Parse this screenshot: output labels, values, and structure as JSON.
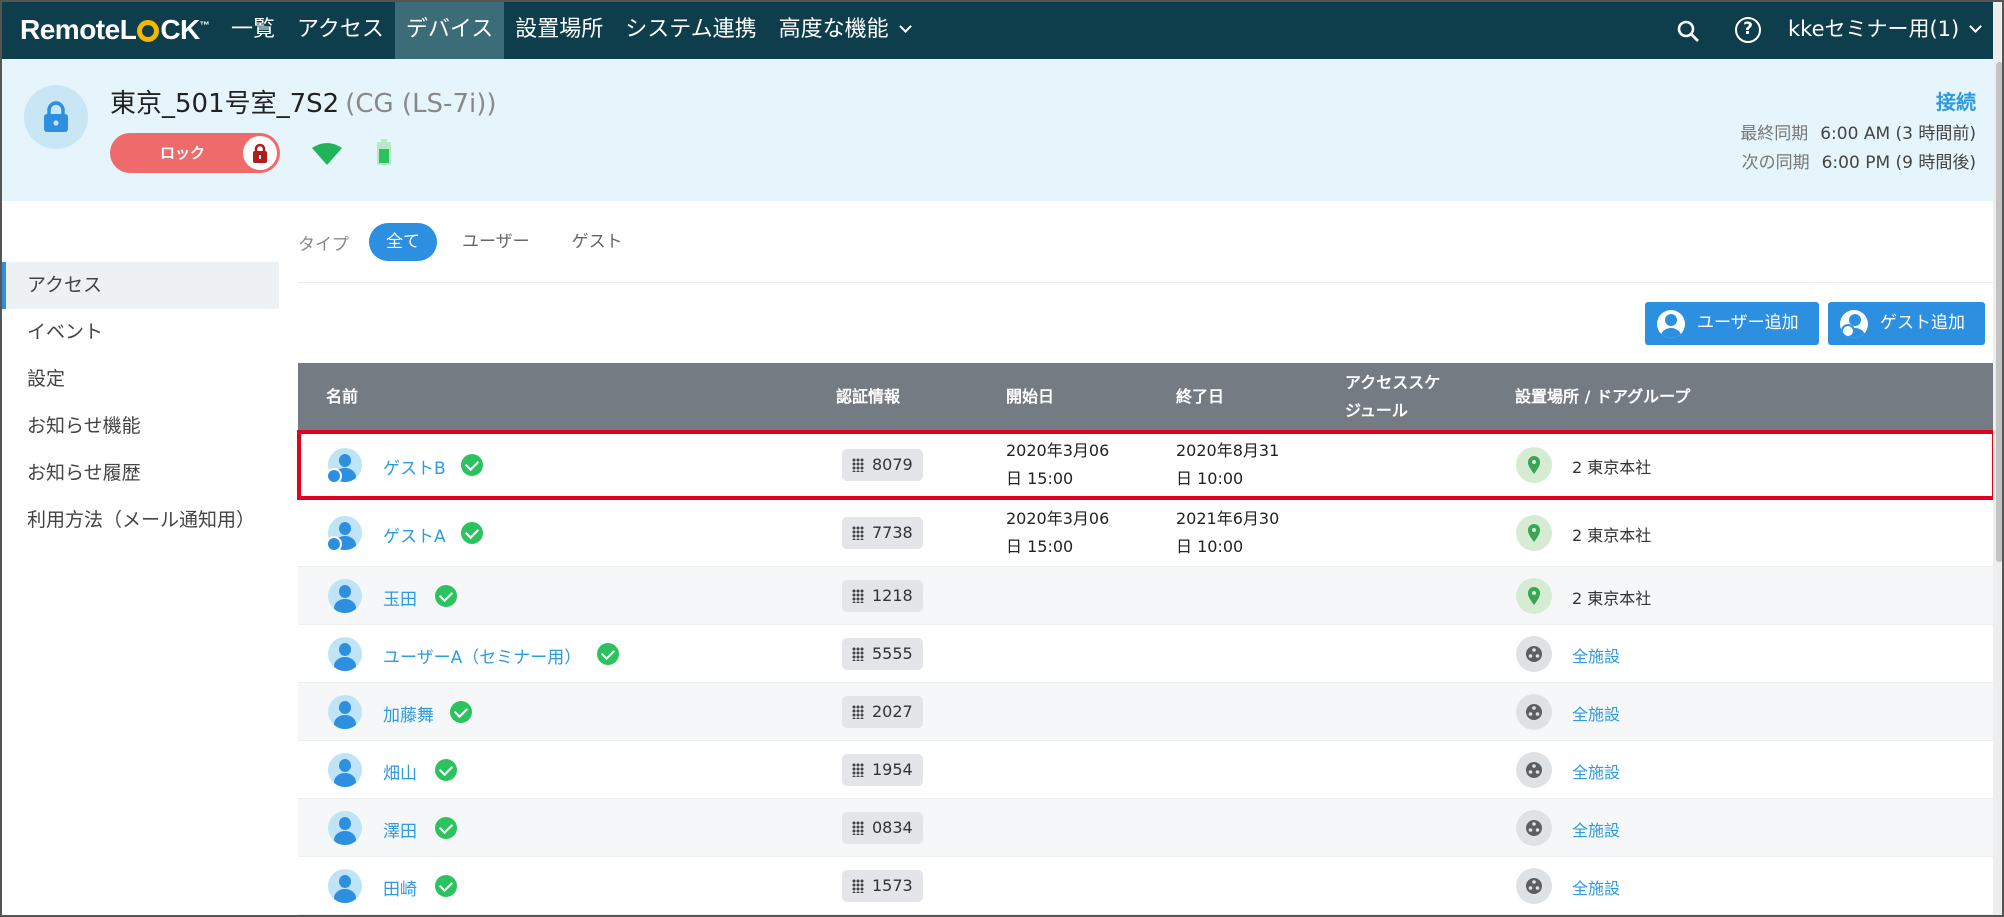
{
  "brand": {
    "logo_left": "Remote",
    "logo_right": "CK",
    "logo_tm": "™"
  },
  "nav": {
    "items": [
      "一覧",
      "アクセス",
      "デバイス",
      "設置場所",
      "システム連携",
      "高度な機能"
    ],
    "active_index": 2,
    "account": "kkeセミナー用(1)"
  },
  "device": {
    "title": "東京_501号室_7S2",
    "model": "(CG (LS-7i))",
    "lock_label": "ロック",
    "status": "接続",
    "last_sync_label": "最終同期",
    "last_sync": "6:00 AM (3 時間前)",
    "next_sync_label": "次の同期",
    "next_sync": "6:00 PM (9 時間後)"
  },
  "sidebar": {
    "items": [
      "アクセス",
      "イベント",
      "設定",
      "お知らせ機能",
      "お知らせ履歴",
      "利用方法（メール通知用）"
    ],
    "active_index": 0
  },
  "filter": {
    "label": "タイプ",
    "tabs": [
      "全て",
      "ユーザー",
      "ゲスト"
    ],
    "active_index": 0
  },
  "actions": {
    "add_user": "ユーザー追加",
    "add_guest": "ゲスト追加"
  },
  "table": {
    "headers": {
      "name": "名前",
      "credential": "認証情報",
      "start": "開始日",
      "end": "終了日",
      "schedule": "アクセススケジュール",
      "location": "設置場所 / ドアグループ"
    },
    "rows": [
      {
        "name": "ゲストB",
        "pin": "8079",
        "start1": "2020年3月06",
        "start2": "日 15:00",
        "end1": "2020年8月31",
        "end2": "日 10:00",
        "location": "2 東京本社",
        "guest": true
      },
      {
        "name": "ゲストA",
        "pin": "7738",
        "start1": "2020年3月06",
        "start2": "日 15:00",
        "end1": "2021年6月30",
        "end2": "日 10:00",
        "location": "2 東京本社",
        "guest": true
      },
      {
        "name": "玉田",
        "pin": "1218",
        "location": "2 東京本社",
        "guest": false
      },
      {
        "name": "ユーザーA（セミナー用）",
        "pin": "5555",
        "location": "全施設",
        "guest": false
      },
      {
        "name": "加藤舞",
        "pin": "2027",
        "location": "全施設",
        "guest": false
      },
      {
        "name": "畑山",
        "pin": "1954",
        "location": "全施設",
        "guest": false
      },
      {
        "name": "澤田",
        "pin": "0834",
        "location": "全施設",
        "guest": false
      },
      {
        "name": "田崎",
        "pin": "1573",
        "location": "全施設",
        "guest": false
      }
    ]
  },
  "colors": {
    "nav_bg": "#0e3d4b",
    "accent": "#2d8fe0",
    "highlight": "#e1001e",
    "lock_btn": "#ef6a6a",
    "check": "#2cc25f"
  }
}
